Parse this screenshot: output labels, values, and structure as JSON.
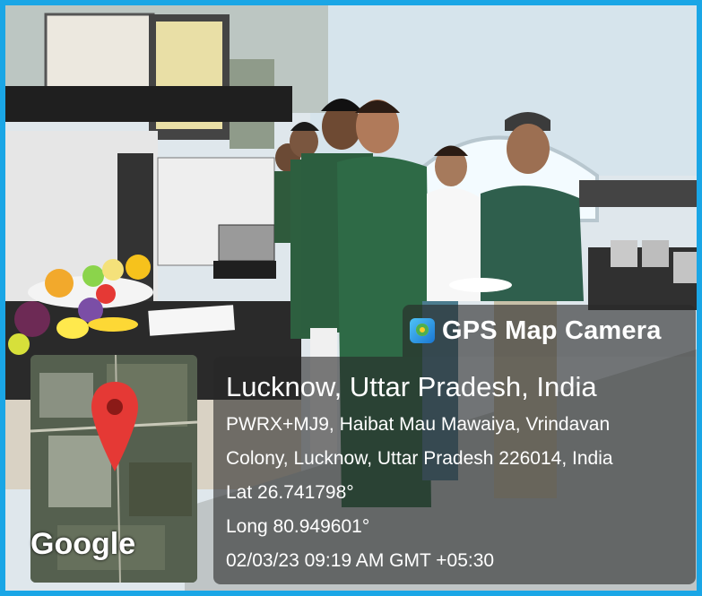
{
  "overlay": {
    "app_icon": "gps-camera-icon",
    "app_name": "GPS Map Camera",
    "location_title": "Lucknow, Uttar Pradesh, India",
    "address_line1": "PWRX+MJ9, Haibat Mau Mawaiya, Vrindavan",
    "address_line2": "Colony, Lucknow, Uttar Pradesh 226014, India",
    "latitude": "Lat 26.741798°",
    "longitude": "Long 80.949601°",
    "datetime": "02/03/23 09:19 AM GMT +05:30"
  },
  "map": {
    "provider_label": "Google",
    "pin_icon": "map-pin-icon",
    "pin_color": "#e53935"
  },
  "colors": {
    "border": "#1aa6e6",
    "overlay_bg": "#282828"
  }
}
